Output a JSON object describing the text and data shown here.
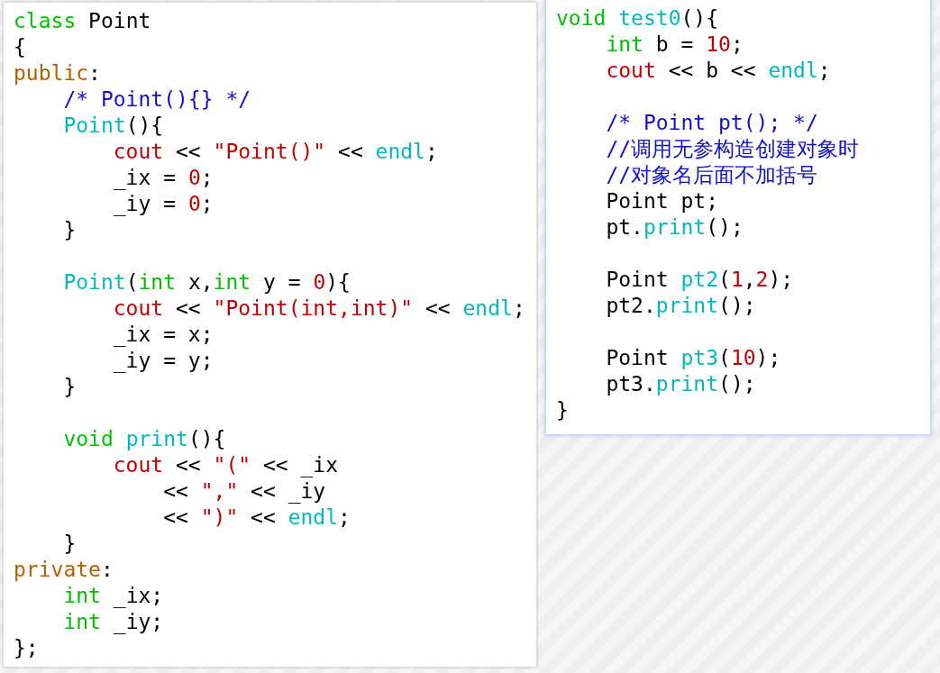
{
  "panels": [
    {
      "lines": [
        {
          "kind": "code",
          "tokens": [
            {
              "kind": "keyword",
              "text": "class"
            },
            {
              "kind": "plain",
              "text": " Point"
            }
          ]
        },
        {
          "kind": "code",
          "tokens": [
            {
              "kind": "plain",
              "text": "{"
            }
          ]
        },
        {
          "kind": "code",
          "tokens": [
            {
              "kind": "access",
              "text": "public"
            },
            {
              "kind": "plain",
              "text": ":"
            }
          ]
        },
        {
          "kind": "code",
          "tokens": [
            {
              "kind": "comment",
              "text": "    /* Point(){} */"
            }
          ]
        },
        {
          "kind": "code",
          "tokens": [
            {
              "kind": "function",
              "text": "    Point"
            },
            {
              "kind": "plain",
              "text": "(){"
            }
          ]
        },
        {
          "kind": "code",
          "tokens": [
            {
              "kind": "literal",
              "text": "        cout"
            },
            {
              "kind": "plain",
              "text": " << "
            },
            {
              "kind": "literal",
              "text": "\"Point()\""
            },
            {
              "kind": "plain",
              "text": " << "
            },
            {
              "kind": "function",
              "text": "endl"
            },
            {
              "kind": "plain",
              "text": ";"
            }
          ]
        },
        {
          "kind": "code",
          "tokens": [
            {
              "kind": "plain",
              "text": "        _ix = "
            },
            {
              "kind": "literal",
              "text": "0"
            },
            {
              "kind": "plain",
              "text": ";"
            }
          ]
        },
        {
          "kind": "code",
          "tokens": [
            {
              "kind": "plain",
              "text": "        _iy = "
            },
            {
              "kind": "literal",
              "text": "0"
            },
            {
              "kind": "plain",
              "text": ";"
            }
          ]
        },
        {
          "kind": "code",
          "tokens": [
            {
              "kind": "plain",
              "text": "    }"
            }
          ]
        },
        {
          "kind": "blank"
        },
        {
          "kind": "code",
          "tokens": [
            {
              "kind": "function",
              "text": "    Point"
            },
            {
              "kind": "plain",
              "text": "("
            },
            {
              "kind": "keyword",
              "text": "int"
            },
            {
              "kind": "plain",
              "text": " x,"
            },
            {
              "kind": "keyword",
              "text": "int"
            },
            {
              "kind": "plain",
              "text": " y = "
            },
            {
              "kind": "literal",
              "text": "0"
            },
            {
              "kind": "plain",
              "text": "){"
            }
          ]
        },
        {
          "kind": "code",
          "tokens": [
            {
              "kind": "literal",
              "text": "        cout"
            },
            {
              "kind": "plain",
              "text": " << "
            },
            {
              "kind": "literal",
              "text": "\"Point(int,int)\""
            },
            {
              "kind": "plain",
              "text": " << "
            },
            {
              "kind": "function",
              "text": "endl"
            },
            {
              "kind": "plain",
              "text": ";"
            }
          ]
        },
        {
          "kind": "code",
          "tokens": [
            {
              "kind": "plain",
              "text": "        _ix = x;"
            }
          ]
        },
        {
          "kind": "code",
          "tokens": [
            {
              "kind": "plain",
              "text": "        _iy = y;"
            }
          ]
        },
        {
          "kind": "code",
          "tokens": [
            {
              "kind": "plain",
              "text": "    }"
            }
          ]
        },
        {
          "kind": "blank"
        },
        {
          "kind": "code",
          "tokens": [
            {
              "kind": "keyword",
              "text": "    void"
            },
            {
              "kind": "function",
              "text": " print"
            },
            {
              "kind": "plain",
              "text": "(){"
            }
          ]
        },
        {
          "kind": "code",
          "tokens": [
            {
              "kind": "literal",
              "text": "        cout"
            },
            {
              "kind": "plain",
              "text": " << "
            },
            {
              "kind": "literal",
              "text": "\"(\""
            },
            {
              "kind": "plain",
              "text": " << _ix"
            }
          ]
        },
        {
          "kind": "code",
          "tokens": [
            {
              "kind": "plain",
              "text": "            << "
            },
            {
              "kind": "literal",
              "text": "\",\""
            },
            {
              "kind": "plain",
              "text": " << _iy"
            }
          ]
        },
        {
          "kind": "code",
          "tokens": [
            {
              "kind": "plain",
              "text": "            << "
            },
            {
              "kind": "literal",
              "text": "\")\""
            },
            {
              "kind": "plain",
              "text": " << "
            },
            {
              "kind": "function",
              "text": "endl"
            },
            {
              "kind": "plain",
              "text": ";"
            }
          ]
        },
        {
          "kind": "code",
          "tokens": [
            {
              "kind": "plain",
              "text": "    }"
            }
          ]
        },
        {
          "kind": "code",
          "tokens": [
            {
              "kind": "access",
              "text": "private"
            },
            {
              "kind": "plain",
              "text": ":"
            }
          ]
        },
        {
          "kind": "code",
          "tokens": [
            {
              "kind": "keyword",
              "text": "    int"
            },
            {
              "kind": "plain",
              "text": " _ix;"
            }
          ]
        },
        {
          "kind": "code",
          "tokens": [
            {
              "kind": "keyword",
              "text": "    int"
            },
            {
              "kind": "plain",
              "text": " _iy;"
            }
          ]
        },
        {
          "kind": "code",
          "tokens": [
            {
              "kind": "plain",
              "text": "};"
            }
          ]
        }
      ]
    },
    {
      "lines": [
        {
          "kind": "code",
          "tokens": [
            {
              "kind": "keyword",
              "text": "void"
            },
            {
              "kind": "function",
              "text": " test0"
            },
            {
              "kind": "plain",
              "text": "(){"
            }
          ]
        },
        {
          "kind": "code",
          "tokens": [
            {
              "kind": "keyword",
              "text": "    int"
            },
            {
              "kind": "plain",
              "text": " b = "
            },
            {
              "kind": "literal",
              "text": "10"
            },
            {
              "kind": "plain",
              "text": ";"
            }
          ]
        },
        {
          "kind": "code",
          "tokens": [
            {
              "kind": "literal",
              "text": "    cout"
            },
            {
              "kind": "plain",
              "text": " << b << "
            },
            {
              "kind": "function",
              "text": "endl"
            },
            {
              "kind": "plain",
              "text": ";"
            }
          ]
        },
        {
          "kind": "blank"
        },
        {
          "kind": "code",
          "tokens": [
            {
              "kind": "comment",
              "text": "    /* Point pt(); */"
            }
          ]
        },
        {
          "kind": "code",
          "tokens": [
            {
              "kind": "comment",
              "text": "    //调用无参构造创建对象时"
            }
          ]
        },
        {
          "kind": "code",
          "tokens": [
            {
              "kind": "comment",
              "text": "    //对象名后面不加括号"
            }
          ]
        },
        {
          "kind": "code",
          "tokens": [
            {
              "kind": "plain",
              "text": "    Point pt;"
            }
          ]
        },
        {
          "kind": "code",
          "tokens": [
            {
              "kind": "plain",
              "text": "    pt."
            },
            {
              "kind": "function",
              "text": "print"
            },
            {
              "kind": "plain",
              "text": "();"
            }
          ]
        },
        {
          "kind": "blank"
        },
        {
          "kind": "code",
          "tokens": [
            {
              "kind": "plain",
              "text": "    Point "
            },
            {
              "kind": "function",
              "text": "pt2"
            },
            {
              "kind": "plain",
              "text": "("
            },
            {
              "kind": "literal",
              "text": "1"
            },
            {
              "kind": "plain",
              "text": ","
            },
            {
              "kind": "literal",
              "text": "2"
            },
            {
              "kind": "plain",
              "text": ");"
            }
          ]
        },
        {
          "kind": "code",
          "tokens": [
            {
              "kind": "plain",
              "text": "    pt2."
            },
            {
              "kind": "function",
              "text": "print"
            },
            {
              "kind": "plain",
              "text": "();"
            }
          ]
        },
        {
          "kind": "blank"
        },
        {
          "kind": "code",
          "tokens": [
            {
              "kind": "plain",
              "text": "    Point "
            },
            {
              "kind": "function",
              "text": "pt3"
            },
            {
              "kind": "plain",
              "text": "("
            },
            {
              "kind": "literal",
              "text": "10"
            },
            {
              "kind": "plain",
              "text": ");"
            }
          ]
        },
        {
          "kind": "code",
          "tokens": [
            {
              "kind": "plain",
              "text": "    pt3."
            },
            {
              "kind": "function",
              "text": "print"
            },
            {
              "kind": "plain",
              "text": "();"
            }
          ]
        },
        {
          "kind": "code",
          "tokens": [
            {
              "kind": "plain",
              "text": "}"
            }
          ]
        }
      ]
    }
  ]
}
